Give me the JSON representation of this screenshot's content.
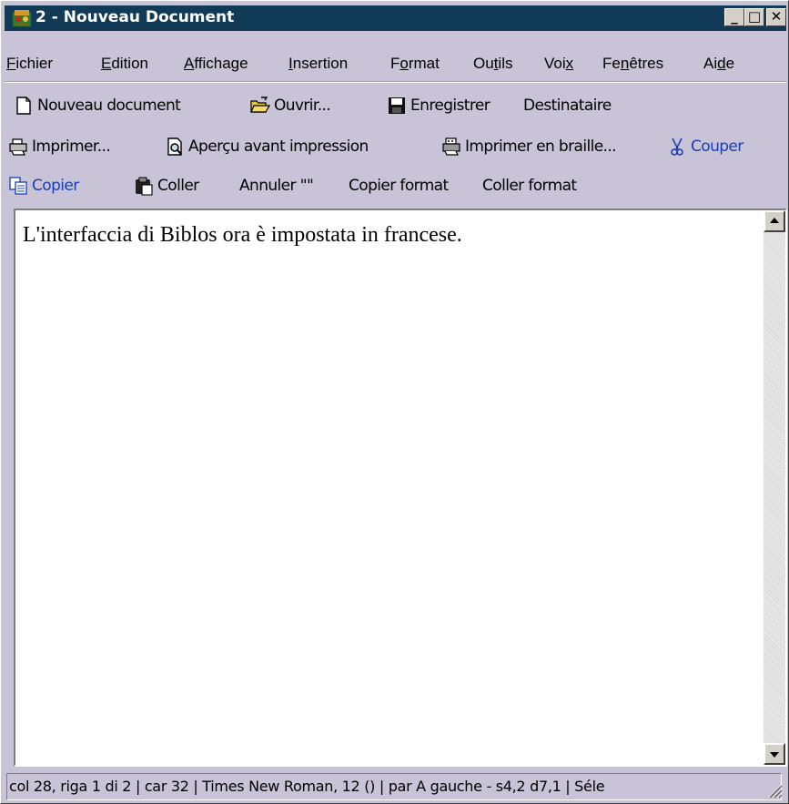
{
  "window": {
    "title": "2 - Nouveau Document"
  },
  "title_buttons": {
    "minimize": "_",
    "maximize": "□",
    "close": "✕"
  },
  "menu": [
    {
      "pre": "",
      "u": "F",
      "post": "ichier"
    },
    {
      "pre": "",
      "u": "E",
      "post": "dition"
    },
    {
      "pre": "",
      "u": "A",
      "post": "ffichage"
    },
    {
      "pre": "",
      "u": "I",
      "post": "nsertion"
    },
    {
      "pre": "F",
      "u": "o",
      "post": "rmat"
    },
    {
      "pre": "Ou",
      "u": "t",
      "post": "ils"
    },
    {
      "pre": "Voi",
      "u": "x",
      "post": ""
    },
    {
      "pre": "Fe",
      "u": "n",
      "post": "êtres"
    },
    {
      "pre": "Ai",
      "u": "d",
      "post": "e"
    }
  ],
  "toolbar": {
    "new_document": "Nouveau document",
    "open": "Ouvrir...",
    "save": "Enregistrer",
    "recipient": "Destinataire",
    "print": "Imprimer...",
    "print_preview": "Aperçu avant impression",
    "print_braille": "Imprimer en braille...",
    "cut": "Couper",
    "copy": "Copier",
    "paste": "Coller",
    "undo": "Annuler \"\"",
    "copy_format": "Copier format",
    "paste_format": "Coller format"
  },
  "document": {
    "text": "L'interfaccia di Biblos ora è impostata in francese."
  },
  "status": {
    "text": "col 28, riga 1 di 2 | car 32 | Times New Roman, 12 () | par A gauche - s4,2 d7,1 | Séle"
  },
  "colors": {
    "titlebar": "#113a57",
    "chrome": "#c8c3d6",
    "disabled_link": "#1a3fb2"
  },
  "icons": [
    "app-icon",
    "new-document-icon",
    "open-folder-icon",
    "save-disk-icon",
    "printer-icon",
    "print-preview-icon",
    "braille-printer-icon",
    "scissors-icon",
    "copy-icon",
    "clipboard-icon",
    "scroll-up-arrow-icon",
    "scroll-down-arrow-icon",
    "resize-grip-icon"
  ]
}
